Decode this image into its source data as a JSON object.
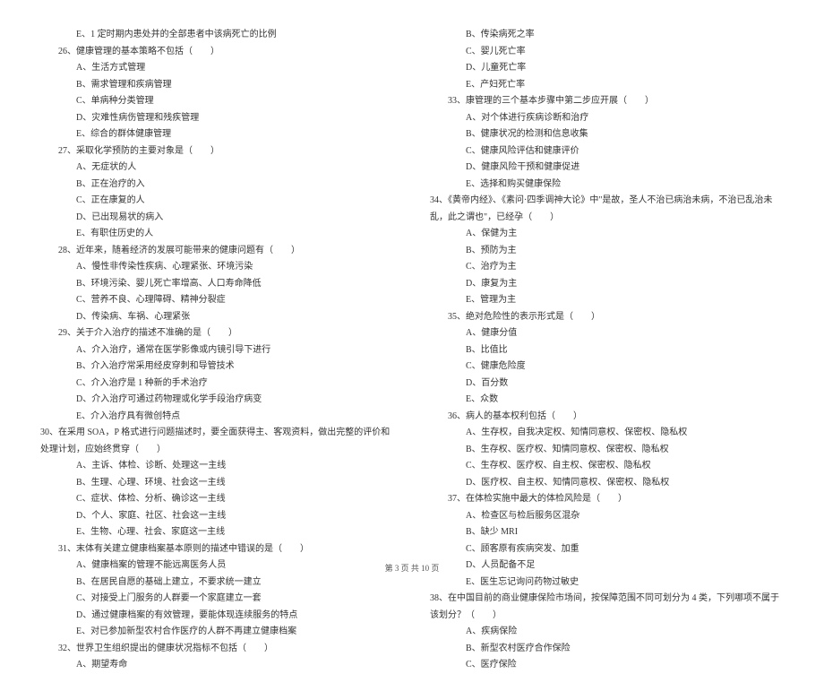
{
  "footer": "第 3 页 共 10 页",
  "left": {
    "q25e": "E、1 定时期内患处并的全部患者中该病死亡的比例",
    "q26": {
      "stem": "26、健康管理的基本策略不包括（　　）",
      "a": "A、生活方式管理",
      "b": "B、需求管理和疾病管理",
      "c": "C、单病种分类管理",
      "d": "D、灾难性病伤管理和残疾管理",
      "e": "E、综合的群体健康管理"
    },
    "q27": {
      "stem": "27、采取化学预防的主要对象是（　　）",
      "a": "A、无症状的人",
      "b": "B、正在治疗的入",
      "c": "C、正在康复的人",
      "d": "D、已出现易状的病入",
      "e": "E、有职住历史的人"
    },
    "q28": {
      "stem": "28、近年来，随着经济的发展可能带来的健康问题有（　　）",
      "a": "A、慢性非传染性疾病、心理紧张、环境污染",
      "b": "B、环境污染、婴儿死亡率增高、人口寿命降低",
      "c": "C、营养不良、心理障碍、精神分裂症",
      "d": "D、传染病、车祸、心理紧张"
    },
    "q29": {
      "stem": "29、关于介入治疗的描述不准确的是（　　）",
      "a": "A、介入治疗，通常在医学影像或内镜引导下进行",
      "b": "B、介入治疗常采用经皮穿刺和导管技术",
      "c": "C、介入治疗是 1 种新的手术治疗",
      "d": "D、介入治疗可通过药物理或化学手段治疗病变",
      "e": "E、介入治疗具有微创特点"
    },
    "q30": {
      "stem": "30、在采用 SOA，P 格式进行问题描述时，要全面获得主、客观资料，做出完整的评价和处理计划，应始终贯穿（　　）",
      "a": "A、主诉、体检、诊断、处理这一主线",
      "b": "B、生理、心理、环境、社会这一主线",
      "c": "C、症状、体检、分析、确诊这一主线",
      "d": "D、个人、家庭、社区、社会这一主线",
      "e": "E、生物、心理、社会、家庭这一主线"
    },
    "q31": {
      "stem": "31、末体有关建立健康档案基本原则的描述中错误的是（　　）",
      "a": "A、健康档案的管理不能远离医务人员",
      "b": "B、在居民自愿的基础上建立，不要求统一建立",
      "c": "C、对接受上门服务的人群要一个家庭建立一套",
      "d": "D、通过健康档案的有效管理，要能体现连续服务的特点",
      "e": "E、对已参加新型农村合作医疗的人群不再建立健康档案"
    },
    "q32": {
      "stem": "32、世界卫生组织提出的健康状况指标不包括（　　）",
      "a": "A、期望寿命"
    }
  },
  "right": {
    "q32cont": {
      "b": "B、传染病死之率",
      "c": "C、婴儿死亡率",
      "d": "D、儿童死亡率",
      "e": "E、产妇死亡率"
    },
    "q33": {
      "stem": "33、康管理的三个基本步骤中第二步应开展（　　）",
      "a": "A、对个体进行疾病诊断和治疗",
      "b": "B、健康状况的检测和信息收集",
      "c": "C、健康风险评估和健康评价",
      "d": "D、健康风险干预和健康促进",
      "e": "E、选择和购买健康保险"
    },
    "q34": {
      "stem": "34、《黄帝内经》、《素问·四季调神大论》中\"是故，圣人不治已病治未病，不治已乱治未乱，此之谓也\"，已经孕（　　）",
      "a": "A、保健为主",
      "b": "B、预防为主",
      "c": "C、治疗为主",
      "d": "D、康复为主",
      "e": "E、管理为主"
    },
    "q35": {
      "stem": "35、绝对危险性的表示形式是（　　）",
      "a": "A、健康分值",
      "b": "B、比值比",
      "c": "C、健康危险度",
      "d": "D、百分数",
      "e": "E、众数"
    },
    "q36": {
      "stem": "36、病人的基本权利包括（　　）",
      "a": "A、生存权，自我决定权、知情同意权、保密权、隐私权",
      "b": "B、生存权、医疗权、知情同意权、保密权、隐私权",
      "c": "C、生存权、医疗权、自主权、保密权、隐私权",
      "d": "D、医疗权、自主权、知情同意权、保密权、隐私权"
    },
    "q37": {
      "stem": "37、在体检实施中最大的体检风险是（　　）",
      "a": "A、检查区与检后服务区混杂",
      "b": "B、缺少 MRI",
      "c": "C、顾客原有疾病突发、加重",
      "d": "D、人员配备不足",
      "e": "E、医生忘记询问药物过敏史"
    },
    "q38": {
      "stem": "38、在中国目前的商业健康保险市场间，按保障范围不同可划分为 4 类，下列哪项不属于该划分？（　　）",
      "a": "A、疾病保险",
      "b": "B、新型农村医疗合作保险",
      "c": "C、医疗保险"
    }
  }
}
